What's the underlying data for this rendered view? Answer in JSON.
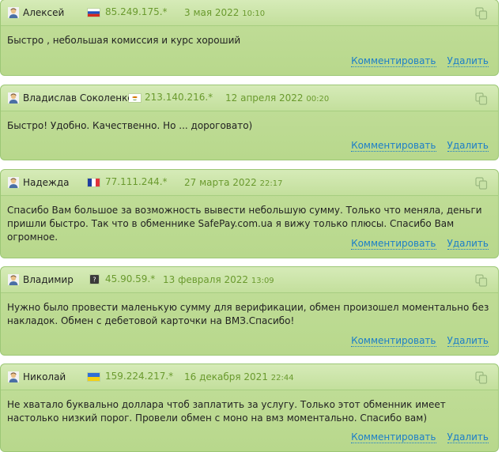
{
  "comments": [
    {
      "author": "Алексей",
      "flag": "ru",
      "ip": "85.249.175.*",
      "date": "3 мая 2022",
      "time": "10:10",
      "text": "Быстро , небольшая комиссия и курс хороший",
      "comment_label": "Комментировать",
      "delete_label": "Удалить"
    },
    {
      "author": "Владислав Соколенко",
      "flag": "cy",
      "ip": "213.140.216.*",
      "date": "12 апреля 2022",
      "time": "00:20",
      "text": "Быстро! Удобно. Качественно. Но ... дороговато)",
      "comment_label": "Комментировать",
      "delete_label": "Удалить"
    },
    {
      "author": "Надежда",
      "flag": "fr",
      "ip": "77.111.244.*",
      "date": "27 марта 2022",
      "time": "22:17",
      "text": "Спасибо Вам большое за возможность вывести небольшую сумму. Только что меняла, деньги пришли быстро. Так что в обменнике SafePay.com.ua я вижу только плюсы. Спасибо Вам огромное.",
      "comment_label": "Комментировать",
      "delete_label": "Удалить"
    },
    {
      "author": "Владимир",
      "flag": "unknown",
      "ip": "45.90.59.*",
      "date": "13 февраля 2022",
      "time": "13:09",
      "text": "Нужно было провести маленькую сумму для верификации, обмен произошел моментально без накладок. Обмен с дебетовой карточки на ВМЗ.Спасибо!",
      "comment_label": "Комментировать",
      "delete_label": "Удалить"
    },
    {
      "author": "Николай",
      "flag": "ua",
      "ip": "159.224.217.*",
      "date": "16 декабря 2021",
      "time": "22:44",
      "text": "Не хватало буквально доллара чтоб заплатить за услугу. Только этот обменник имеет настолько низкий порог. Провели обмен с моно на вмз моментально. Спасибо вам)",
      "comment_label": "Комментировать",
      "delete_label": "Удалить"
    }
  ]
}
